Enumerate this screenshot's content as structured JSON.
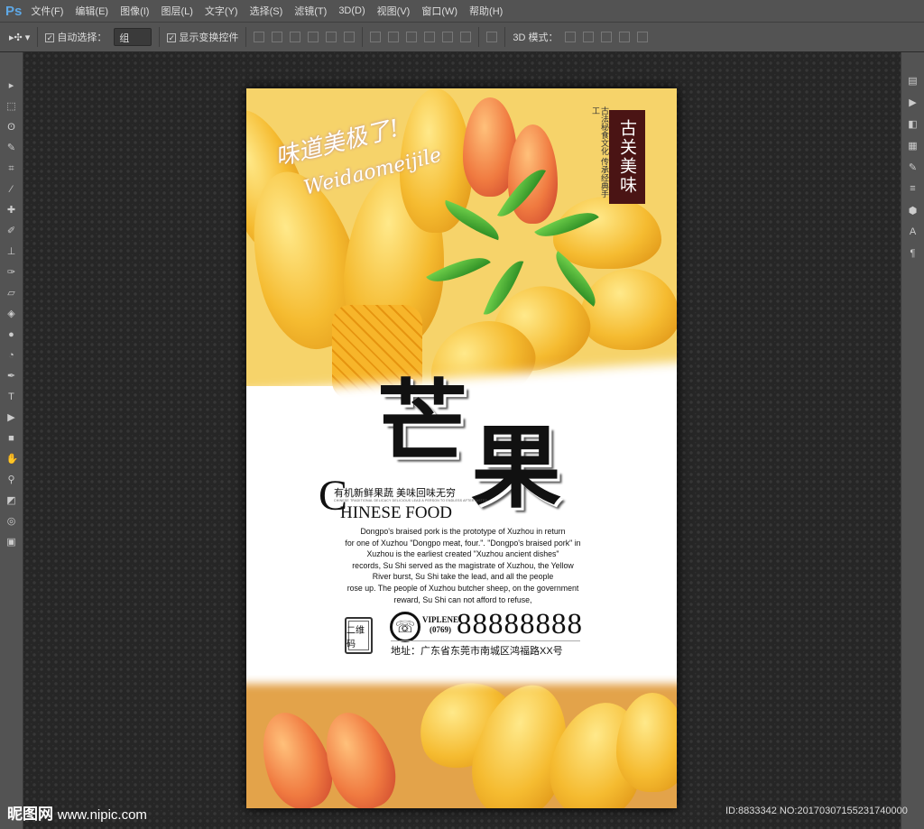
{
  "app": {
    "logo": "Ps"
  },
  "menu": [
    "文件(F)",
    "编辑(E)",
    "图像(I)",
    "图层(L)",
    "文字(Y)",
    "选择(S)",
    "滤镜(T)",
    "3D(D)",
    "视图(V)",
    "窗口(W)",
    "帮助(H)"
  ],
  "options": {
    "auto_select_label": "自动选择：",
    "auto_select_value": "组",
    "show_transform_label": "显示变换控件",
    "mode3d_label": "3D 模式："
  },
  "poster": {
    "script_cn": "味道美极了!",
    "script_en": "Weidaomeijile",
    "seal": "古关美味",
    "seal_side": "古法秘食文化 传承经典手工",
    "title_chars": [
      "芒",
      "果"
    ],
    "slogan": "有机新鲜果蔬  美味回味无穷",
    "subslogan": "CHINESE TRADITIONAL DELICACY DELICIOUS LEAD A PERSON TO ENDLESS AFTERTASTES",
    "big_c": "C",
    "chinese_food": "HINESE FOOD",
    "paragraph": [
      "Dongpo's braised pork is the prototype of Xuzhou in return",
      "for one of Xuzhou \"Dongpo meat, four.\". \"Dongpo's braised pork\" in",
      "Xuzhou is the earliest created \"Xuzhou ancient dishes\"",
      "records, Su Shi served as the magistrate of Xuzhou, the Yellow",
      "River burst, Su Shi take the lead, and all the people",
      "rose up. The people of Xuzhou butcher sheep, on the government",
      "reward, Su Shi can not afford to refuse,"
    ],
    "qr_label": "二维码",
    "phone_icon": "☏",
    "vip": "VIPLENE",
    "area_code": "(0769)",
    "phone": "88888888",
    "address": "地址：广东省东莞市南城区鸿福路XX号"
  },
  "watermark": {
    "logo": "昵图网",
    "url": "www.nipic.com",
    "id": "ID:8833342 NO:20170307155231740000"
  }
}
